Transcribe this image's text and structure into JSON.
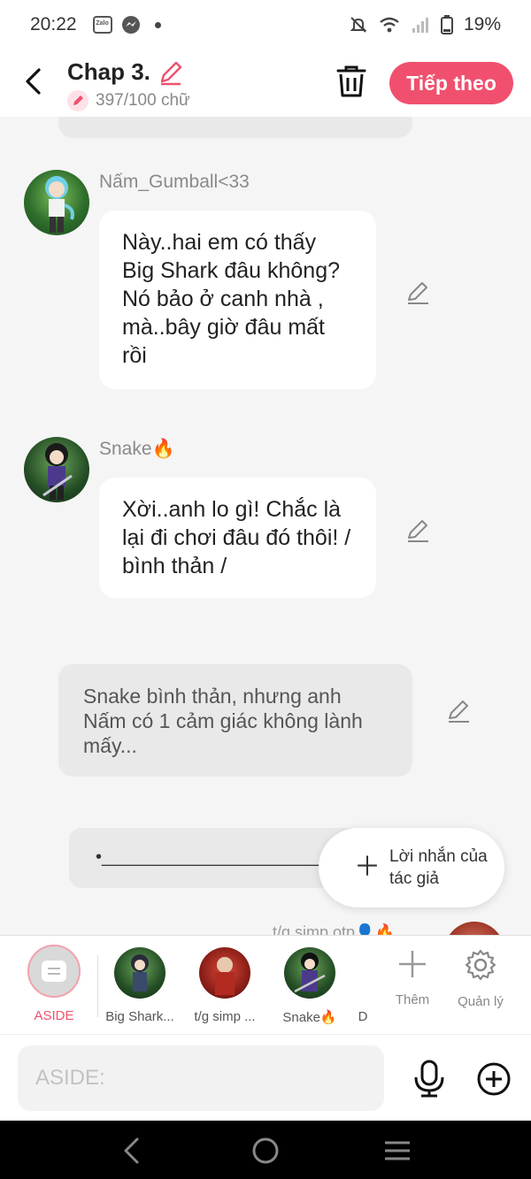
{
  "status_bar": {
    "time": "20:22",
    "battery": "19%",
    "zalo_label": "Zalo"
  },
  "header": {
    "chapter_title": "Chap 3.",
    "word_count": "397/100 chữ",
    "next_label": "Tiếp theo"
  },
  "messages": [
    {
      "character": "Nấm_Gumball<33",
      "text": "Này..hai em có thấy Big Shark đâu không? Nó bảo ở canh nhà , mà..bây giờ đâu mất rồi"
    },
    {
      "character": "Snake🔥",
      "text": "Xời..anh lo gì! Chắc là lại đi chơi đâu đó thôi! / bình thản /"
    }
  ],
  "narration": {
    "text": "Snake bình thản, nhưng anh Nấm có 1 cảm giác không lành mấy..."
  },
  "draft_snippet": "•___________________________",
  "author_note_label": "Lời nhắn của tác giả",
  "peek_label": "t/g simp otp👤🔥",
  "character_bar": {
    "aside_label": "ASIDE",
    "characters": [
      "Big Shark...",
      "t/g simp ...",
      "Snake🔥",
      "D"
    ],
    "add_label": "Thêm",
    "manage_label": "Quản lý"
  },
  "composer": {
    "placeholder": "ASIDE:"
  },
  "colors": {
    "accent": "#f0506e",
    "bubble": "#ffffff",
    "narration_bg": "#e9e9e9",
    "background": "#f5f5f5"
  },
  "icons": {
    "status": [
      "zalo-icon",
      "messenger-icon",
      "mute-icon",
      "wifi-icon",
      "signal-icon",
      "battery-icon"
    ],
    "header": [
      "back-icon",
      "pencil-icon",
      "trash-icon"
    ],
    "composer": [
      "microphone-icon",
      "add-circle-icon"
    ]
  }
}
